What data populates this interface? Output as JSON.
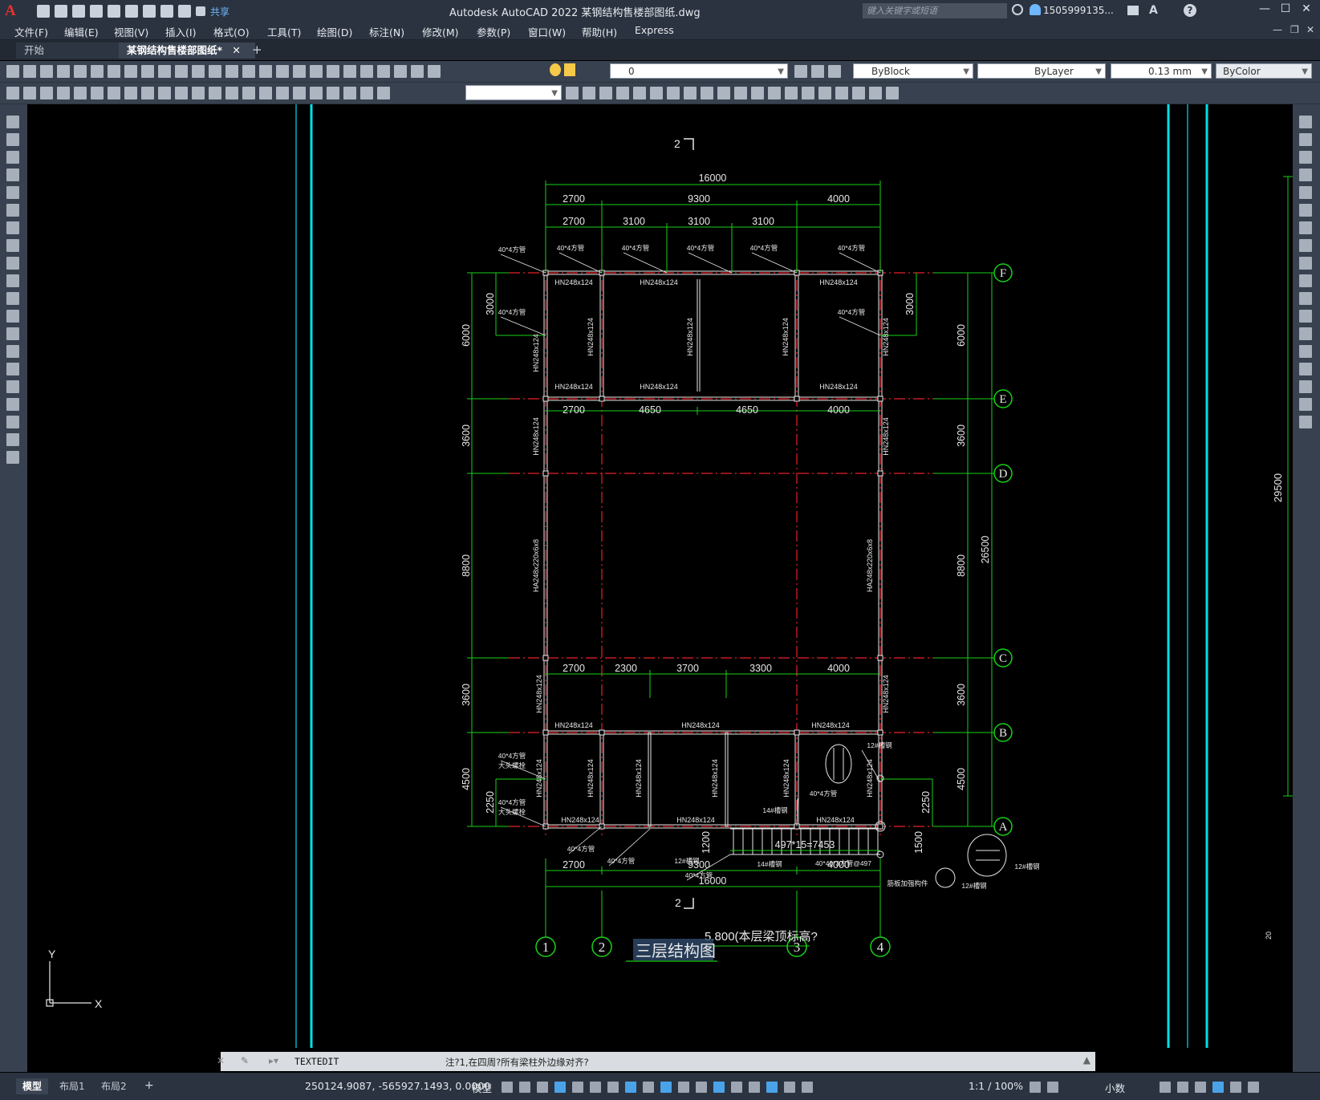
{
  "app": {
    "title": "Autodesk AutoCAD 2022    某钢结构售楼部图纸.dwg",
    "search_placeholder": "键入关键字或短语",
    "user": "1505999135...",
    "share_label": "共享"
  },
  "menu": [
    "文件(F)",
    "编辑(E)",
    "视图(V)",
    "插入(I)",
    "格式(O)",
    "工具(T)",
    "绘图(D)",
    "标注(N)",
    "修改(M)",
    "参数(P)",
    "窗口(W)",
    "帮助(H)",
    "Express"
  ],
  "tabs": [
    {
      "label": "开始",
      "active": false
    },
    {
      "label": "某钢结构售楼部图纸*",
      "active": true
    }
  ],
  "properties": {
    "layer": "0",
    "color": "ByBlock",
    "linetype": "ByLayer",
    "lineweight": "0.13 mm",
    "plotstyle": "ByColor"
  },
  "command": {
    "name": "TEXTEDIT",
    "prompt": "注?1,在四周?所有梁柱外边缘对齐?"
  },
  "status": {
    "layout_tabs": [
      {
        "label": "模型",
        "active": true
      },
      {
        "label": "布局1",
        "active": false
      },
      {
        "label": "布局2",
        "active": false
      }
    ],
    "coords": "250124.9087, -565927.1493, 0.0000",
    "model_label": "模型",
    "scale": "1:1 / 100%",
    "units": "小数"
  },
  "drawing": {
    "section_top": "2",
    "section_bottom": "2",
    "title": "三层结构图",
    "elevation": "5.800(本层梁顶标高?",
    "overall_width": "16000",
    "top_dims_row1": [
      "2700",
      "9300",
      "4000"
    ],
    "top_dims_row2": [
      "2700",
      "3100",
      "3100",
      "3100"
    ],
    "mid_dims_upper": [
      "2700",
      "4650",
      "4650",
      "4000"
    ],
    "mid_dims_lower": [
      "2700",
      "2300",
      "3700",
      "3300",
      "4000"
    ],
    "bottom_dims": [
      "2700",
      "9300",
      "4000"
    ],
    "overall_width_bottom": "16000",
    "stair_dim": "497*15=7453",
    "left_dims": [
      "6000",
      "3600",
      "8800",
      "3600",
      "4500"
    ],
    "left_sub_dims": [
      "3000",
      "2250"
    ],
    "right_dims": [
      "6000",
      "3600",
      "8800",
      "3600",
      "4500"
    ],
    "right_sub_dims": [
      "3000",
      "2250",
      "1500",
      "1200"
    ],
    "total_height": "26500",
    "sheet_height": "29500",
    "grid_rows": [
      "F",
      "E",
      "D",
      "C",
      "B",
      "A"
    ],
    "grid_cols": [
      "1",
      "2",
      "3",
      "4"
    ],
    "beam_label": "HN248x124",
    "column_label": "HA248x220x6x8",
    "tube_label": "40*4方管",
    "rod_label": "12#槽钢",
    "rod_label2": "14#槽钢",
    "stair_note": "40*40*3方管@497",
    "connection_note": "大头螺栓",
    "side_note": "筋板加强构件",
    "small_mark": "20"
  }
}
